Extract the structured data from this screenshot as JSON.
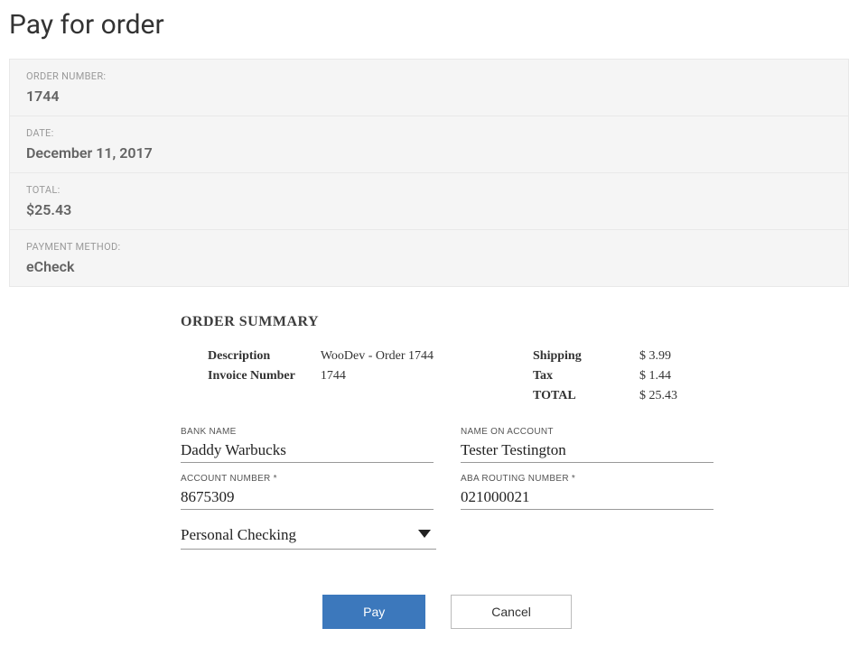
{
  "page_title": "Pay for order",
  "order": {
    "number_label": "Order number:",
    "number_value": "1744",
    "date_label": "Date:",
    "date_value": "December 11, 2017",
    "total_label": "Total:",
    "total_value": "$25.43",
    "payment_method_label": "Payment method:",
    "payment_method_value": "eCheck"
  },
  "summary": {
    "title": "ORDER SUMMARY",
    "description_label": "Description",
    "description_value": "WooDev - Order 1744",
    "invoice_label": "Invoice Number",
    "invoice_value": "1744",
    "shipping_label": "Shipping",
    "shipping_value": "$ 3.99",
    "tax_label": "Tax",
    "tax_value": "$ 1.44",
    "total_label": "TOTAL",
    "total_value": "$ 25.43"
  },
  "form": {
    "bank_name_label": "BANK NAME",
    "bank_name_value": "Daddy Warbucks",
    "name_on_account_label": "NAME ON ACCOUNT",
    "name_on_account_value": "Tester Testington",
    "account_number_label": "ACCOUNT NUMBER *",
    "account_number_value": "8675309",
    "aba_routing_label": "ABA ROUTING NUMBER *",
    "aba_routing_value": "021000021",
    "account_type_value": "Personal Checking"
  },
  "buttons": {
    "pay": "Pay",
    "cancel": "Cancel"
  }
}
